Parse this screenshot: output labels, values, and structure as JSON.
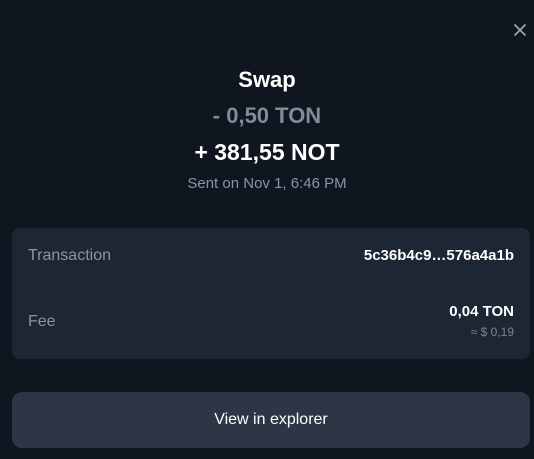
{
  "header": {
    "close_icon": "close-icon"
  },
  "swap": {
    "title": "Swap",
    "sent_amount": "- 0,50 TON",
    "received_amount": "+ 381,55 NOT",
    "sent_time": "Sent on Nov 1, 6:46 PM"
  },
  "details": {
    "transaction_label": "Transaction",
    "transaction_hash": "5c36b4c9…576a4a1b",
    "fee_label": "Fee",
    "fee_amount": "0,04 TON",
    "fee_usd": "≈ $ 0,19"
  },
  "actions": {
    "explorer_label": "View in explorer"
  },
  "colors": {
    "background": "#10161f",
    "card": "#1d2633",
    "button": "#2d3644",
    "muted_text": "#8b94a2"
  }
}
